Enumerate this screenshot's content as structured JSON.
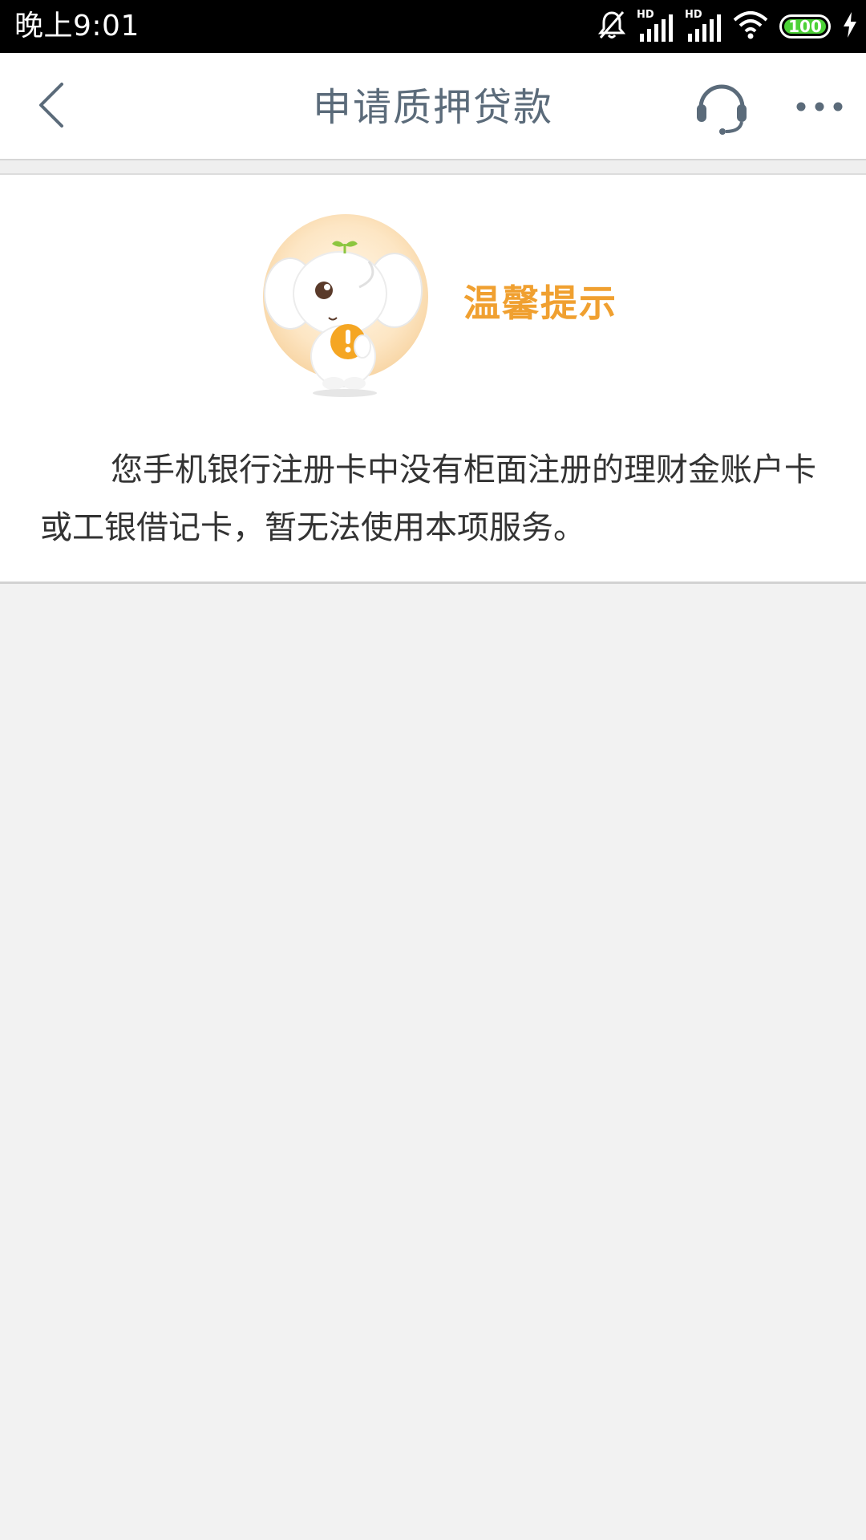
{
  "status_bar": {
    "time": "晚上9:01",
    "hd1": "HD",
    "hd2": "HD",
    "battery": "100",
    "icons": [
      "bell-off-icon",
      "signal-icon",
      "signal-icon",
      "wifi-icon",
      "battery-icon",
      "charging-icon"
    ]
  },
  "nav": {
    "title": "申请质押贷款",
    "icons": [
      "back-icon",
      "headset-icon",
      "more-icon"
    ]
  },
  "notice": {
    "title": "温馨提示",
    "message": "您手机银行注册卡中没有柜面注册的理财金账户卡或工银借记卡，暂无法使用本项服务。"
  },
  "colors": {
    "nav_text": "#5b6b7a",
    "tip_orange": "#f0a030",
    "battery_green": "#4cd137",
    "page_bg": "#f2f2f2"
  }
}
